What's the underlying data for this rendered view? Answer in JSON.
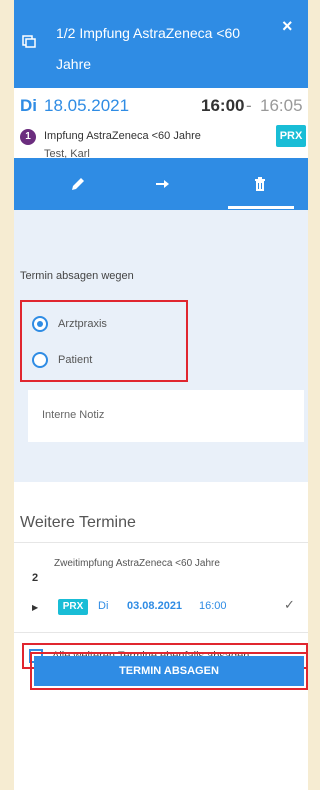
{
  "header": {
    "title": "1/2 Impfung AstraZeneca <60 Jahre",
    "close_glyph": "×",
    "icon": "calendar-icon",
    "color": "#2f8ce4"
  },
  "appointment": {
    "day": "Di",
    "date": "18.05.2021",
    "time_start": "16:00",
    "time_sep": "-",
    "time_end": "16:05",
    "number": "1",
    "name": "Impfung AstraZeneca <60 Jahre",
    "badge": "PRX",
    "patient": "Test, Karl"
  },
  "actions": [
    {
      "name": "edit-button",
      "icon": "pencil-icon"
    },
    {
      "name": "move-button",
      "icon": "arrow-right-icon"
    },
    {
      "name": "delete-button",
      "icon": "trash-icon",
      "active": true
    }
  ],
  "cancel": {
    "label": "Termin absagen wegen",
    "options": [
      {
        "label": "Arztpraxis",
        "selected": true
      },
      {
        "label": "Patient",
        "selected": false
      }
    ],
    "note_placeholder": "Interne Notiz"
  },
  "further": {
    "heading": "Weitere Termine",
    "items": [
      {
        "index": "2",
        "name": "Zweitimpfung AstraZeneca <60 Jahre",
        "badge": "PRX",
        "day": "Di",
        "date": "03.08.2021",
        "time": "16:00",
        "check": "✓"
      }
    ],
    "cancel_all_label": "Alle weiteren Termine ebenfalls absagen",
    "cancel_all_checked": false
  },
  "submit_label": "TERMIN ABSAGEN",
  "colors": {
    "accent": "#2f8ce4",
    "badge": "#19bdd6",
    "highlight": "#e0262f",
    "number_badge": "#6b2d7e"
  }
}
